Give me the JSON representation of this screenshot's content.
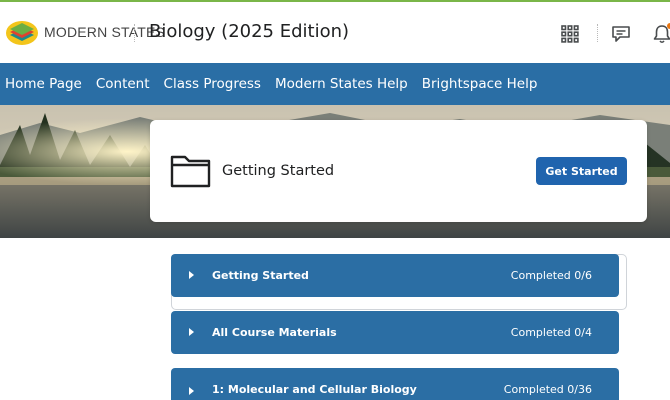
{
  "header": {
    "brand_text": "MODERN STATES",
    "course_title": "Biology (2025 Edition)",
    "icons": [
      "apps-grid-icon",
      "chat-icon",
      "bell-icon"
    ]
  },
  "nav": {
    "items": [
      {
        "label": "Home Page"
      },
      {
        "label": "Content"
      },
      {
        "label": "Class Progress"
      },
      {
        "label": "Modern States Help"
      },
      {
        "label": "Brightspace Help"
      }
    ]
  },
  "card": {
    "title": "Getting Started",
    "button_label": "Get Started",
    "icon": "folder-icon"
  },
  "modules": [
    {
      "title": "Getting Started",
      "status": "Completed 0/6"
    },
    {
      "title": "All Course Materials",
      "status": "Completed 0/4"
    },
    {
      "title": "1: Molecular and Cellular Biology",
      "status": "Completed 0/36"
    }
  ],
  "colors": {
    "nav_bg": "#2a6ea5",
    "module_bg": "#2b6ea4",
    "button_bg": "#2064ae",
    "top_accent": "#7ab648",
    "notification": "#e87511"
  }
}
